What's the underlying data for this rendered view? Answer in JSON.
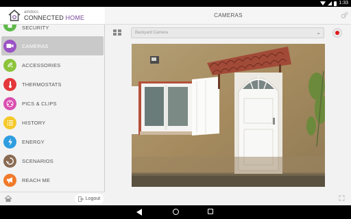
{
  "status_bar": {
    "time": "1:33"
  },
  "brand": {
    "small": "amdocs",
    "main": "CONNECTED",
    "accent": "HOME",
    "accent_color": "#7b4a9e"
  },
  "menu": [
    {
      "label": "SECURITY",
      "icon": "lock-icon",
      "color": "#5fb84a",
      "active": false
    },
    {
      "label": "CAMERAS",
      "icon": "video-camera-icon",
      "color": "#9b53c4",
      "active": true
    },
    {
      "label": "ACCESSORIES",
      "icon": "wifi-icon",
      "color": "#8cc43c",
      "active": false
    },
    {
      "label": "THERMOSTATS",
      "icon": "thermometer-icon",
      "color": "#e4373a",
      "active": false
    },
    {
      "label": "PICS & CLIPS",
      "icon": "film-icon",
      "color": "#d94fb0",
      "active": false
    },
    {
      "label": "HISTORY",
      "icon": "list-icon",
      "color": "#f5c92b",
      "active": false
    },
    {
      "label": "ENERGY",
      "icon": "lightning-icon",
      "color": "#2f9de0",
      "active": false
    },
    {
      "label": "SCENARIOS",
      "icon": "scenario-icon",
      "color": "#8a6a52",
      "active": false
    },
    {
      "label": "REACH ME",
      "icon": "megaphone-icon",
      "color": "#f07a2a",
      "active": false
    }
  ],
  "footer": {
    "logout_label": "Logout"
  },
  "main": {
    "title": "CAMERAS",
    "camera_select": {
      "value": "Backyard Camera"
    }
  }
}
